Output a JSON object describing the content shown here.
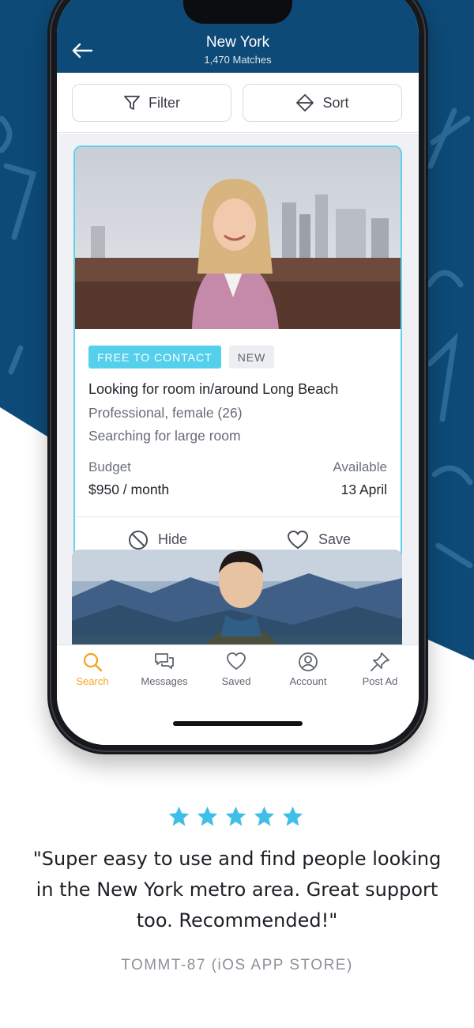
{
  "header": {
    "title": "New York",
    "subtitle": "1,470 Matches"
  },
  "toolbar": {
    "filter_label": "Filter",
    "sort_label": "Sort"
  },
  "listing": {
    "badges": [
      "FREE TO CONTACT",
      "NEW"
    ],
    "title": "Looking for room in/around Long Beach",
    "profile": "Professional, female (26)",
    "searching": "Searching for large room",
    "budget_label": "Budget",
    "budget_value": "$950 / month",
    "available_label": "Available",
    "available_value": "13 April",
    "hide_label": "Hide",
    "save_label": "Save"
  },
  "tabs": [
    {
      "label": "Search",
      "icon": "search-icon",
      "active": true
    },
    {
      "label": "Messages",
      "icon": "messages-icon",
      "active": false
    },
    {
      "label": "Saved",
      "icon": "heart-icon",
      "active": false
    },
    {
      "label": "Account",
      "icon": "account-icon",
      "active": false
    },
    {
      "label": "Post Ad",
      "icon": "pin-icon",
      "active": false
    }
  ],
  "review": {
    "rating": 5,
    "quote": "\"Super easy to use and find people looking in the New York metro area. Great support too. Recommended!\"",
    "author": "TOMMT-87 (iOS APP STORE)"
  },
  "colors": {
    "brand_blue": "#0d4a77",
    "accent_cyan": "#55d0ec",
    "active_tab": "#f2a51a",
    "star": "#3fbfe8"
  }
}
